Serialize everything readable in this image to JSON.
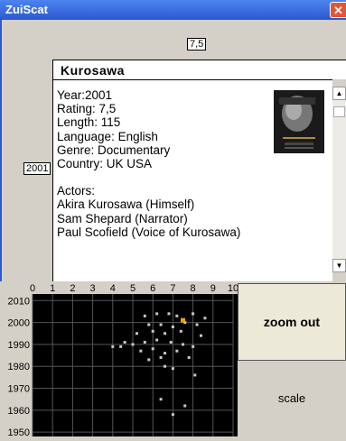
{
  "window": {
    "title": "ZuiScat",
    "close_glyph": "✕"
  },
  "markers": {
    "rating": "7,5",
    "year": "2001"
  },
  "movie": {
    "title": "Kurosawa",
    "details": [
      "Year:2001",
      "Rating: 7,5",
      "Length: 115",
      "Language: English",
      "Genre: Documentary",
      "Country: UK USA"
    ],
    "actors_heading": "Actors:",
    "actors": [
      "Akira Kurosawa (Himself)",
      "Sam Shepard (Narrator)",
      "Paul Scofield (Voice of Kurosawa)"
    ]
  },
  "controls": {
    "zoom_out": "zoom out",
    "scale": "scale"
  },
  "chart_data": {
    "type": "scatter",
    "x_ticks": [
      "0",
      "1",
      "2",
      "3",
      "4",
      "5",
      "6",
      "7",
      "8",
      "9",
      "10"
    ],
    "y_ticks": [
      "2010",
      "2000",
      "1990",
      "1980",
      "1970",
      "1960",
      "1950"
    ],
    "xlim": [
      0,
      10
    ],
    "ylim": [
      1948,
      2013
    ],
    "grid": true,
    "point_color": "#c8c8c8",
    "highlight_color": "#f0a000",
    "highlight": {
      "x": 7.5,
      "y": 2001
    },
    "points": [
      [
        5.6,
        2003
      ],
      [
        6.2,
        2004
      ],
      [
        6.8,
        2004
      ],
      [
        7.2,
        2003
      ],
      [
        8.0,
        2004
      ],
      [
        8.6,
        2002
      ],
      [
        5.8,
        1999
      ],
      [
        6.4,
        1999
      ],
      [
        7.0,
        1998
      ],
      [
        7.6,
        2000
      ],
      [
        8.2,
        1999
      ],
      [
        5.2,
        1995
      ],
      [
        6.0,
        1996
      ],
      [
        6.6,
        1995
      ],
      [
        7.4,
        1996
      ],
      [
        8.4,
        1994
      ],
      [
        4.6,
        1991
      ],
      [
        5.0,
        1990
      ],
      [
        5.6,
        1991
      ],
      [
        6.2,
        1992
      ],
      [
        6.9,
        1991
      ],
      [
        7.5,
        1990
      ],
      [
        8.0,
        1989
      ],
      [
        4.0,
        1989
      ],
      [
        4.4,
        1989
      ],
      [
        5.4,
        1987
      ],
      [
        6.0,
        1988
      ],
      [
        6.6,
        1986
      ],
      [
        7.2,
        1987
      ],
      [
        5.8,
        1983
      ],
      [
        6.4,
        1984
      ],
      [
        7.8,
        1984
      ],
      [
        6.6,
        1980
      ],
      [
        7.0,
        1979
      ],
      [
        8.1,
        1976
      ],
      [
        6.4,
        1965
      ],
      [
        7.6,
        1962
      ],
      [
        7.0,
        1958
      ]
    ]
  }
}
